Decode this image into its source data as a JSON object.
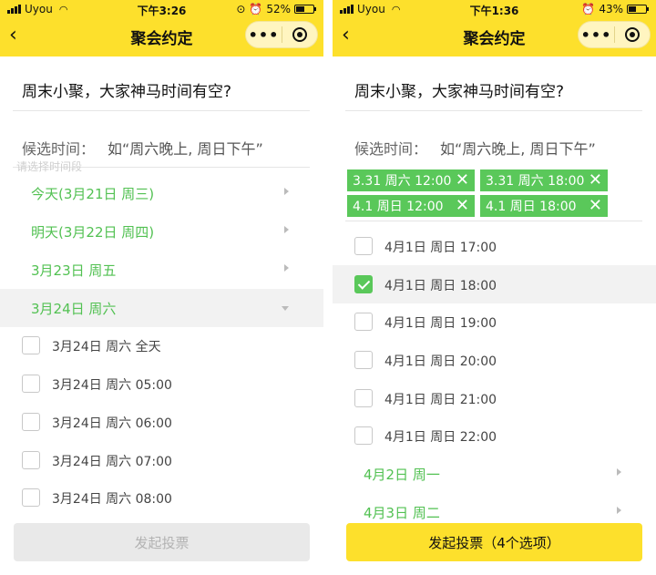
{
  "left": {
    "status": {
      "carrier": "Uyou",
      "time": "下午3:26",
      "battery": "52%",
      "battery_level": 0.52
    },
    "nav": {
      "title": "聚会约定"
    },
    "question": "周末小聚，大家神马时间有空?",
    "candidate": {
      "label": "候选时间：",
      "placeholder": "如“周六晚上, 周日下午”"
    },
    "ghost_text": "请选择时间段",
    "days": [
      "今天(3月21日 周三)",
      "明天(3月22日 周四)",
      "3月23日 周五",
      "3月24日 周六"
    ],
    "slots": [
      "3月24日 周六 全天",
      "3月24日 周六 05:00",
      "3月24日 周六 06:00",
      "3月24日 周六 07:00",
      "3月24日 周六 08:00"
    ],
    "submit": "发起投票"
  },
  "right": {
    "status": {
      "carrier": "Uyou",
      "time": "下午1:36",
      "battery": "43%",
      "battery_level": 0.43
    },
    "nav": {
      "title": "聚会约定"
    },
    "question": "周末小聚，大家神马时间有空?",
    "candidate": {
      "label": "候选时间：",
      "placeholder": "如“周六晚上, 周日下午”"
    },
    "tags": [
      "3.31 周六 12:00",
      "3.31 周六 18:00",
      "4.1 周日 12:00",
      "4.1 周日 18:00"
    ],
    "slots": [
      "4月1日 周日 17:00",
      "4月1日 周日 18:00",
      "4月1日 周日 19:00",
      "4月1日 周日 20:00",
      "4月1日 周日 21:00",
      "4月1日 周日 22:00"
    ],
    "slot_checked": [
      false,
      true,
      false,
      false,
      false,
      false
    ],
    "days": [
      "4月2日 周一",
      "4月3日 周二"
    ],
    "submit": "发起投票（4个选项）"
  },
  "colors": {
    "brand_yellow": "#fde02c",
    "accent_green": "#5ac85a",
    "day_green": "#52c152"
  },
  "icons": {
    "back": "chevron-left-icon",
    "more": "more-dots-icon",
    "close": "target-close-icon",
    "remove": "close-x-icon"
  }
}
